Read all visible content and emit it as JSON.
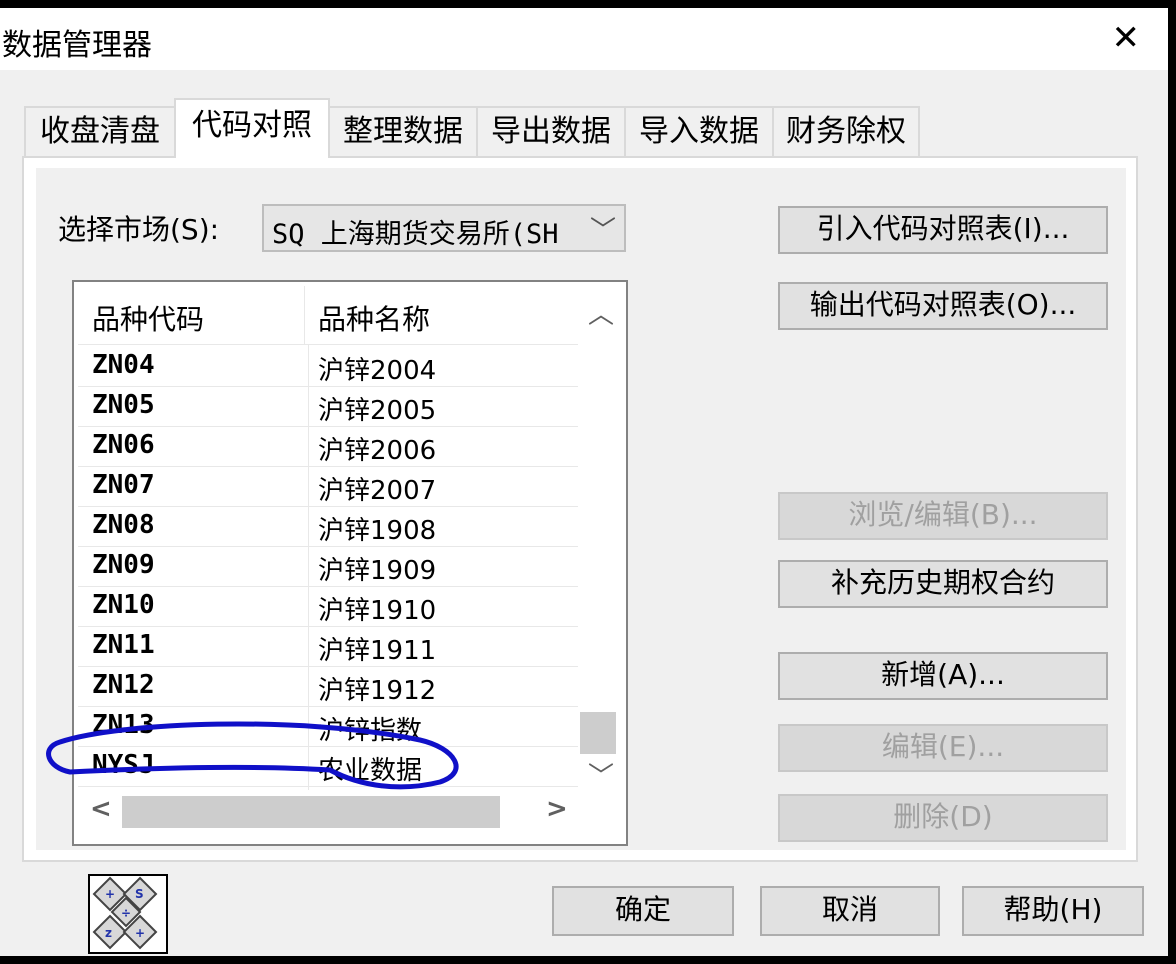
{
  "window": {
    "title": "数据管理器",
    "close_glyph": "✕"
  },
  "tabs": [
    "收盘清盘",
    "代码对照",
    "整理数据",
    "导出数据",
    "导入数据",
    "财务除权"
  ],
  "market": {
    "label": "选择市场(S):",
    "value": "SQ 上海期货交易所(SH",
    "arrow_glyph": "﹀"
  },
  "list": {
    "headers": [
      "品种代码",
      "品种名称"
    ],
    "rows": [
      {
        "code": "ZN04",
        "name": "沪锌2004"
      },
      {
        "code": "ZN05",
        "name": "沪锌2005"
      },
      {
        "code": "ZN06",
        "name": "沪锌2006"
      },
      {
        "code": "ZN07",
        "name": "沪锌2007"
      },
      {
        "code": "ZN08",
        "name": "沪锌1908"
      },
      {
        "code": "ZN09",
        "name": "沪锌1909"
      },
      {
        "code": "ZN10",
        "name": "沪锌1910"
      },
      {
        "code": "ZN11",
        "name": "沪锌1911"
      },
      {
        "code": "ZN12",
        "name": "沪锌1912"
      },
      {
        "code": "ZN13",
        "name": "沪锌指数"
      },
      {
        "code": "NYSJ",
        "name": "农业数据"
      }
    ],
    "scroll_up_glyph": "︿",
    "scroll_down_glyph": "﹀",
    "scroll_left_glyph": "<",
    "scroll_right_glyph": ">"
  },
  "buttons": {
    "import_map": "引入代码对照表(I)...",
    "export_map": "输出代码对照表(O)...",
    "browse_edit": "浏览/编辑(B)...",
    "supplement": "补充历史期权合约",
    "add": "新增(A)...",
    "edit": "编辑(E)...",
    "delete": "删除(D)",
    "ok": "确定",
    "cancel": "取消",
    "help": "帮助(H)"
  },
  "colors": {
    "annotation": "#1010c8",
    "logo_blue": "#2233aa"
  },
  "icons": {
    "logo": "keyboard-logo-icon"
  }
}
